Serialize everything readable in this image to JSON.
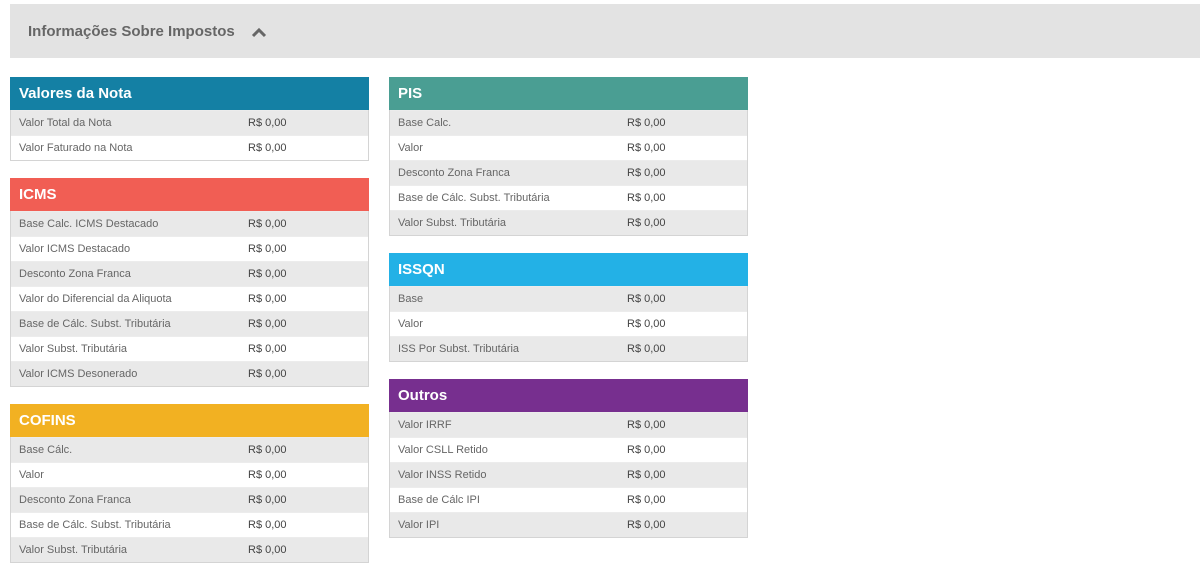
{
  "section": {
    "title": "Informações Sobre Impostos"
  },
  "colors": {
    "valores": "#1480a4",
    "icms": "#f15e54",
    "cofins": "#f2b122",
    "pis": "#4a9e93",
    "issqn": "#23b1e6",
    "outros": "#772f8f"
  },
  "panels": {
    "valores": {
      "title": "Valores da Nota",
      "rows": [
        {
          "label": "Valor Total da Nota",
          "value": "R$ 0,00"
        },
        {
          "label": "Valor Faturado na Nota",
          "value": "R$ 0,00"
        }
      ]
    },
    "icms": {
      "title": "ICMS",
      "rows": [
        {
          "label": "Base Calc. ICMS Destacado",
          "value": "R$ 0,00"
        },
        {
          "label": "Valor ICMS Destacado",
          "value": "R$ 0,00"
        },
        {
          "label": "Desconto Zona Franca",
          "value": "R$ 0,00"
        },
        {
          "label": "Valor do Diferencial da Aliquota",
          "value": "R$ 0,00"
        },
        {
          "label": "Base de Cálc. Subst. Tributária",
          "value": "R$ 0,00"
        },
        {
          "label": "Valor Subst. Tributária",
          "value": "R$ 0,00"
        },
        {
          "label": "Valor ICMS Desonerado",
          "value": "R$ 0,00"
        }
      ]
    },
    "cofins": {
      "title": "COFINS",
      "rows": [
        {
          "label": "Base Cálc.",
          "value": "R$ 0,00"
        },
        {
          "label": "Valor",
          "value": "R$ 0,00"
        },
        {
          "label": "Desconto Zona Franca",
          "value": "R$ 0,00"
        },
        {
          "label": "Base de Cálc. Subst. Tributária",
          "value": "R$ 0,00"
        },
        {
          "label": "Valor Subst. Tributária",
          "value": "R$ 0,00"
        }
      ]
    },
    "pis": {
      "title": "PIS",
      "rows": [
        {
          "label": "Base Calc.",
          "value": "R$ 0,00"
        },
        {
          "label": "Valor",
          "value": "R$ 0,00"
        },
        {
          "label": "Desconto Zona Franca",
          "value": "R$ 0,00"
        },
        {
          "label": "Base de Cálc. Subst. Tributária",
          "value": "R$ 0,00"
        },
        {
          "label": "Valor Subst. Tributária",
          "value": "R$ 0,00"
        }
      ]
    },
    "issqn": {
      "title": "ISSQN",
      "rows": [
        {
          "label": "Base",
          "value": "R$ 0,00"
        },
        {
          "label": "Valor",
          "value": "R$ 0,00"
        },
        {
          "label": "ISS Por Subst. Tributária",
          "value": "R$ 0,00"
        }
      ]
    },
    "outros": {
      "title": "Outros",
      "rows": [
        {
          "label": "Valor IRRF",
          "value": "R$ 0,00"
        },
        {
          "label": "Valor CSLL Retido",
          "value": "R$ 0,00"
        },
        {
          "label": "Valor INSS Retido",
          "value": "R$ 0,00"
        },
        {
          "label": "Base de Cálc IPI",
          "value": "R$ 0,00"
        },
        {
          "label": "Valor IPI",
          "value": "R$ 0,00"
        }
      ]
    }
  }
}
